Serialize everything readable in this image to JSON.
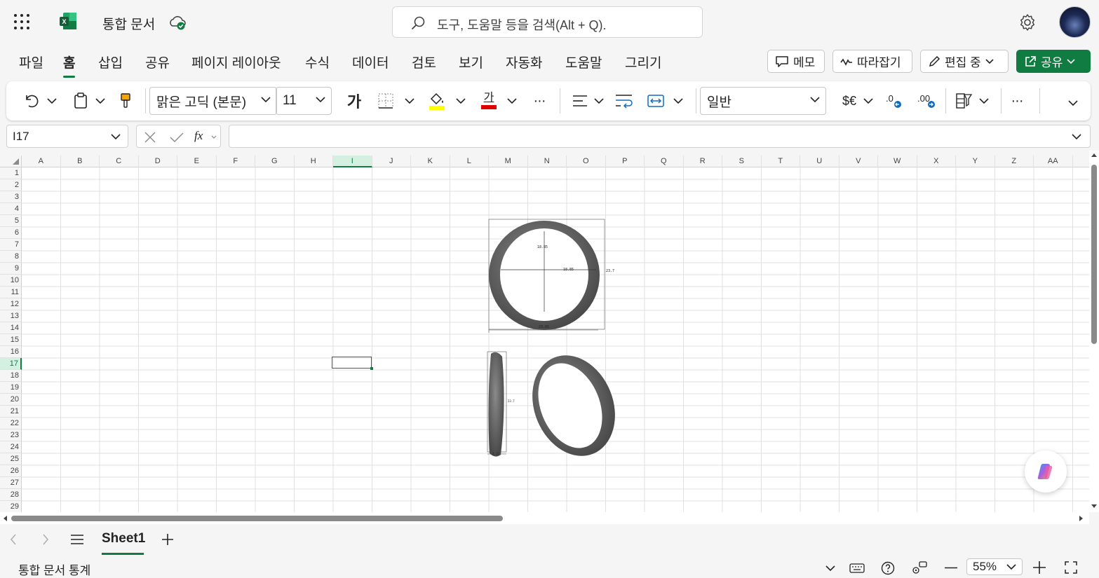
{
  "app": {
    "document_title": "통합 문서",
    "search_placeholder": "도구, 도움말 등을 검색(Alt + Q)."
  },
  "menu": {
    "tabs": [
      "파일",
      "홈",
      "삽입",
      "공유",
      "페이지 레이아웃",
      "수식",
      "데이터",
      "검토",
      "보기",
      "자동화",
      "도움말",
      "그리기"
    ],
    "active_tab": "홈",
    "memo_label": "메모",
    "follow_label": "따라잡기",
    "editing_label": "편집 중",
    "share_label": "공유"
  },
  "ribbon": {
    "font_name": "맑은 고딕 (본문)",
    "font_size": "11",
    "bold_glyph": "가",
    "font_color_glyph": "가",
    "number_format": "일반",
    "currency_glyph": "$€",
    "more_glyph": "···"
  },
  "formula_bar": {
    "name_box": "I17",
    "fx_label": "fx",
    "formula": ""
  },
  "grid": {
    "columns": [
      "A",
      "B",
      "C",
      "D",
      "E",
      "F",
      "G",
      "H",
      "I",
      "J",
      "K",
      "L",
      "M",
      "N",
      "O",
      "P",
      "Q",
      "R",
      "S",
      "T",
      "U",
      "V",
      "W",
      "X",
      "Y",
      "Z",
      "AA"
    ],
    "rows": [
      "1",
      "2",
      "3",
      "4",
      "5",
      "6",
      "7",
      "8",
      "9",
      "10",
      "11",
      "12",
      "13",
      "14",
      "15",
      "16",
      "17",
      "18",
      "19",
      "20",
      "21",
      "22",
      "23",
      "24",
      "25",
      "26",
      "27",
      "28",
      "29"
    ],
    "selected_column": "I",
    "selected_row": "17"
  },
  "drawing": {
    "dims": [
      "18.85",
      "18.85",
      "23.7",
      "23.85",
      "23.7",
      "3.15"
    ]
  },
  "sheets": {
    "tabs": [
      "Sheet1"
    ],
    "active": "Sheet1"
  },
  "status": {
    "left_text": "통합 문서 통계",
    "zoom": "55%"
  },
  "colors": {
    "accent": "#107c41",
    "selection_fill": "#d3f0e0",
    "highlight_yellow": "#ffff00",
    "font_red": "#e00000"
  }
}
